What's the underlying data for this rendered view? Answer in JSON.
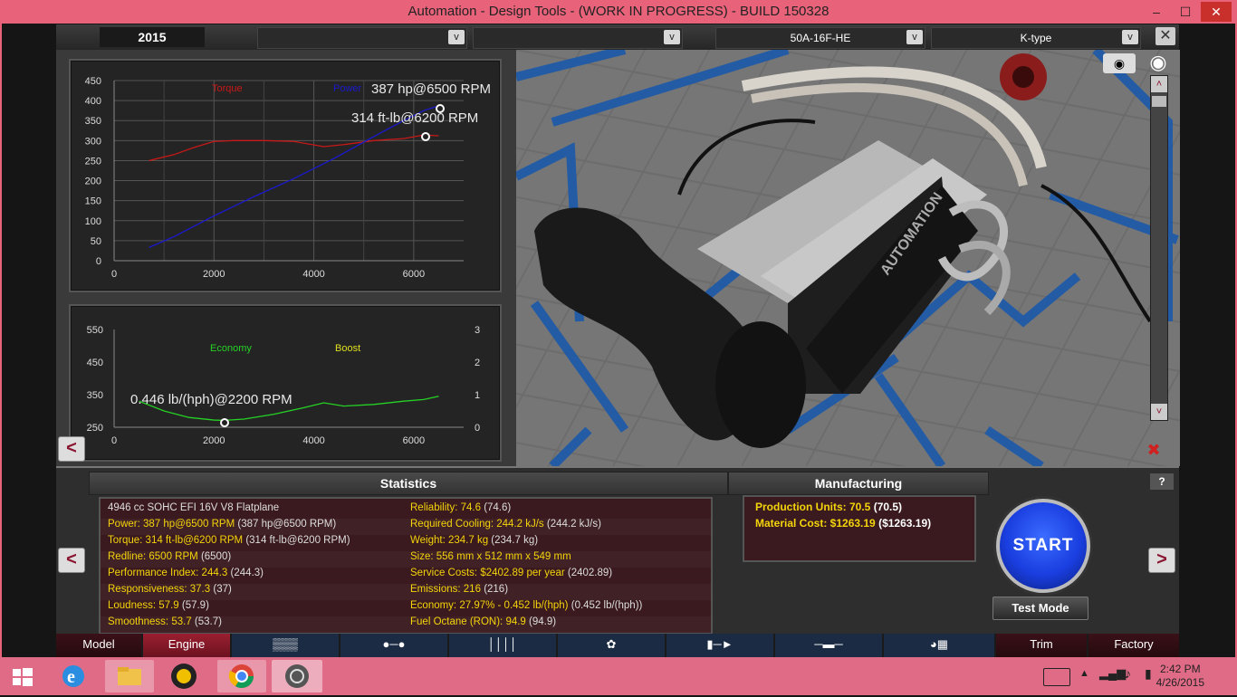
{
  "window": {
    "title": "Automation - Design Tools - (WORK IN PROGRESS) - BUILD 150328",
    "minimize": "–",
    "maximize": "☐",
    "close": "✕"
  },
  "topbar": {
    "year": "2015",
    "dropdown1": "",
    "dropdown2": "",
    "engine_family": "50A-16F-HE",
    "variant": "K-type",
    "dropdown_arrow": "v",
    "close": "✕"
  },
  "power_chart": {
    "legend_torque": "Torque",
    "legend_power": "Power",
    "power_annotation": "387 hp@6500 RPM",
    "torque_annotation": "314 ft-lb@6200 RPM",
    "y_ticks": [
      "450",
      "400",
      "350",
      "300",
      "250",
      "200",
      "150",
      "100",
      "50",
      "0"
    ],
    "x_ticks": [
      "0",
      "2000",
      "4000",
      "6000"
    ]
  },
  "econ_chart": {
    "legend_economy": "Economy",
    "legend_boost": "Boost",
    "economy_annotation": "0.446 lb/(hph)@2200 RPM",
    "y_ticks_left": [
      "550",
      "450",
      "350",
      "250"
    ],
    "y_ticks_right": [
      "3",
      "2",
      "1",
      "0"
    ],
    "x_ticks": [
      "0",
      "2000",
      "4000",
      "6000"
    ]
  },
  "chart_data": [
    {
      "type": "line",
      "xlim": [
        0,
        7000
      ],
      "ylim": [
        0,
        450
      ],
      "series": [
        {
          "name": "Torque",
          "color": "#c81818",
          "x": [
            700,
            1200,
            1600,
            2000,
            2400,
            3000,
            3600,
            4200,
            4600,
            5200,
            5800,
            6200,
            6500
          ],
          "y": [
            250,
            265,
            283,
            298,
            300,
            300,
            298,
            285,
            290,
            300,
            305,
            314,
            312
          ]
        },
        {
          "name": "Power",
          "color": "#1a1ad0",
          "x": [
            700,
            1200,
            2000,
            2800,
            3600,
            4400,
            5200,
            5800,
            6200,
            6500
          ],
          "y": [
            33,
            60,
            112,
            160,
            205,
            255,
            310,
            350,
            375,
            387
          ]
        }
      ]
    },
    {
      "type": "line",
      "xlim": [
        0,
        7000
      ],
      "ylim": [
        250,
        550
      ],
      "series": [
        {
          "name": "Economy",
          "color": "#25d225",
          "x": [
            500,
            1000,
            1500,
            2000,
            2200,
            2600,
            3200,
            3800,
            4200,
            4600,
            5200,
            5800,
            6200,
            6500
          ],
          "y": [
            330,
            300,
            280,
            272,
            271,
            275,
            290,
            310,
            325,
            315,
            320,
            330,
            335,
            345
          ]
        },
        {
          "name": "Boost",
          "color": "#e0e020",
          "x": [],
          "y": []
        }
      ]
    }
  ],
  "nav": {
    "left": "<",
    "right": ">"
  },
  "statistics": {
    "header": "Statistics",
    "left": [
      {
        "label": "4946 cc SOHC EFI 16V V8 Flatplane",
        "value": ""
      },
      {
        "label": "Power: 387 hp@6500 RPM",
        "value": "(387 hp@6500 RPM)"
      },
      {
        "label": "Torque: 314 ft-lb@6200 RPM",
        "value": "(314 ft-lb@6200 RPM)"
      },
      {
        "label": "Redline: 6500 RPM",
        "value": "(6500)"
      },
      {
        "label": "Performance Index: 244.3",
        "value": "(244.3)"
      },
      {
        "label": "Responsiveness: 37.3",
        "value": "(37)"
      },
      {
        "label": "Loudness: 57.9",
        "value": "(57.9)"
      },
      {
        "label": "Smoothness: 53.7",
        "value": "(53.7)"
      }
    ],
    "right": [
      {
        "label": "Reliability: 74.6",
        "value": "(74.6)"
      },
      {
        "label": "Required Cooling: 244.2 kJ/s",
        "value": "(244.2 kJ/s)"
      },
      {
        "label": "Weight: 234.7 kg",
        "value": "(234.7 kg)"
      },
      {
        "label": "Size: 556 mm x 512 mm x 549 mm",
        "value": ""
      },
      {
        "label": "Service Costs: $2402.89 per year",
        "value": "(2402.89)"
      },
      {
        "label": "Emissions: 216",
        "value": "(216)"
      },
      {
        "label": "Economy: 27.97% - 0.452 lb/(hph)",
        "value": "(0.452 lb/(hph))"
      },
      {
        "label": "Fuel Octane (RON): 94.9",
        "value": "(94.9)"
      }
    ]
  },
  "manufacturing": {
    "header": "Manufacturing",
    "production_label": "Production Units: 70.5",
    "production_value": "(70.5)",
    "material_label": "Material Cost: $1263.19",
    "material_value": "($1263.19)"
  },
  "controls": {
    "start": "START",
    "test_mode": "Test Mode",
    "help": "?"
  },
  "tabs": [
    {
      "label": "Model",
      "icon": ""
    },
    {
      "label": "Engine",
      "icon": ""
    },
    {
      "label": "",
      "icon": "block-icon"
    },
    {
      "label": "",
      "icon": "crank-icon"
    },
    {
      "label": "",
      "icon": "pistons-icon"
    },
    {
      "label": "",
      "icon": "turbo-icon"
    },
    {
      "label": "",
      "icon": "fuel-icon"
    },
    {
      "label": "",
      "icon": "exhaust-icon"
    },
    {
      "label": "",
      "icon": "tuning-icon"
    },
    {
      "label": "Trim",
      "icon": ""
    },
    {
      "label": "Factory",
      "icon": ""
    }
  ],
  "taskbar": {
    "time": "2:42 PM",
    "date": "4/26/2015"
  },
  "colors": {
    "accent_yellow": "#f4d40a",
    "titlebar": "#e8627a",
    "taskbar": "#e06b86",
    "tab_active": "#8a1a2a"
  }
}
